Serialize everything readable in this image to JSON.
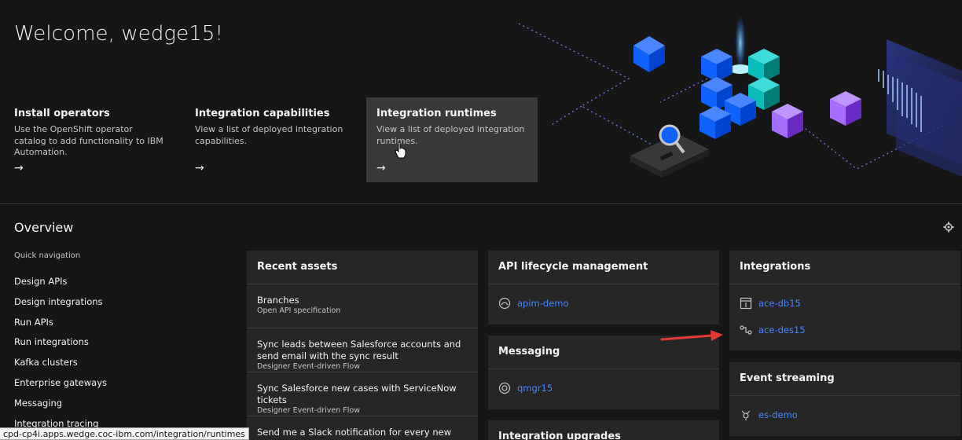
{
  "welcome": "Welcome, wedge15!",
  "tiles": [
    {
      "title": "Install operators",
      "desc": "Use the OpenShift operator catalog to add functionality to IBM Automation.",
      "arrow": "→"
    },
    {
      "title": "Integration capabilities",
      "desc": "View a list of deployed integration capabilities.",
      "arrow": "→"
    },
    {
      "title": "Integration runtimes",
      "desc": "View a list of deployed integration runtimes.",
      "arrow": "→"
    }
  ],
  "overview": {
    "title": "Overview",
    "quick_nav_label": "Quick navigation",
    "quick_nav": [
      "Design APIs",
      "Design integrations",
      "Run APIs",
      "Run integrations",
      "Kafka clusters",
      "Enterprise gateways",
      "Messaging",
      "Integration tracing"
    ]
  },
  "recent_assets": {
    "title": "Recent assets",
    "items": [
      {
        "name": "Branches",
        "sub": "Open API specification"
      },
      {
        "name": "Sync leads between Salesforce accounts and send email with the sync result",
        "sub": "Designer Event-driven Flow"
      },
      {
        "name": "Sync Salesforce new cases with ServiceNow tickets",
        "sub": "Designer Event-driven Flow"
      },
      {
        "name": "Send me a Slack notification for every new",
        "sub": ""
      }
    ]
  },
  "api_lifecycle": {
    "title": "API lifecycle management",
    "items": [
      {
        "label": "apim-demo",
        "icon": "api-icon"
      }
    ]
  },
  "messaging": {
    "title": "Messaging",
    "items": [
      {
        "label": "qmgr15",
        "icon": "queue-manager-icon"
      }
    ]
  },
  "integration_upgrades": {
    "title": "Integration upgrades"
  },
  "integrations": {
    "title": "Integrations",
    "items": [
      {
        "label": "ace-db15",
        "icon": "dashboard-icon"
      },
      {
        "label": "ace-des15",
        "icon": "designer-flow-icon"
      }
    ]
  },
  "event_streaming": {
    "title": "Event streaming",
    "items": [
      {
        "label": "es-demo",
        "icon": "event-streams-icon"
      }
    ]
  },
  "status_url": "cpd-cp4i.apps.wedge.coc-ibm.com/integration/runtimes",
  "colors": {
    "background": "#161616",
    "card": "#262626",
    "tile_hover": "#393939",
    "link": "#4589ff",
    "annotation_arrow": "#e53935"
  }
}
